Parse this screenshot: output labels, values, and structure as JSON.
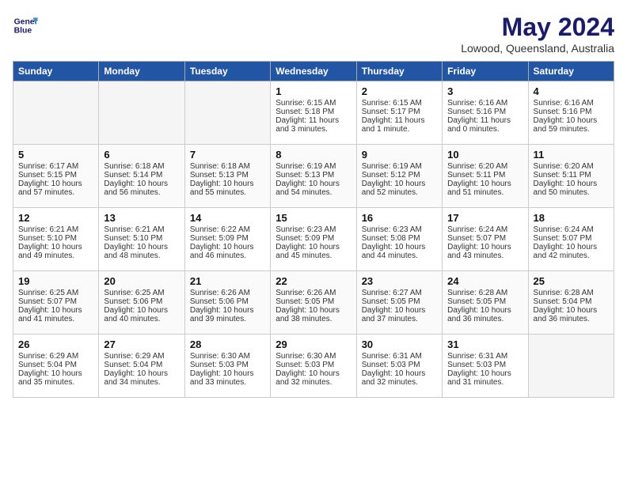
{
  "header": {
    "logo_line1": "General",
    "logo_line2": "Blue",
    "title": "May 2024",
    "subtitle": "Lowood, Queensland, Australia"
  },
  "days_of_week": [
    "Sunday",
    "Monday",
    "Tuesday",
    "Wednesday",
    "Thursday",
    "Friday",
    "Saturday"
  ],
  "weeks": [
    [
      {
        "day": "",
        "info": ""
      },
      {
        "day": "",
        "info": ""
      },
      {
        "day": "",
        "info": ""
      },
      {
        "day": "1",
        "info": "Sunrise: 6:15 AM\nSunset: 5:18 PM\nDaylight: 11 hours and 3 minutes."
      },
      {
        "day": "2",
        "info": "Sunrise: 6:15 AM\nSunset: 5:17 PM\nDaylight: 11 hours and 1 minute."
      },
      {
        "day": "3",
        "info": "Sunrise: 6:16 AM\nSunset: 5:16 PM\nDaylight: 11 hours and 0 minutes."
      },
      {
        "day": "4",
        "info": "Sunrise: 6:16 AM\nSunset: 5:16 PM\nDaylight: 10 hours and 59 minutes."
      }
    ],
    [
      {
        "day": "5",
        "info": "Sunrise: 6:17 AM\nSunset: 5:15 PM\nDaylight: 10 hours and 57 minutes."
      },
      {
        "day": "6",
        "info": "Sunrise: 6:18 AM\nSunset: 5:14 PM\nDaylight: 10 hours and 56 minutes."
      },
      {
        "day": "7",
        "info": "Sunrise: 6:18 AM\nSunset: 5:13 PM\nDaylight: 10 hours and 55 minutes."
      },
      {
        "day": "8",
        "info": "Sunrise: 6:19 AM\nSunset: 5:13 PM\nDaylight: 10 hours and 54 minutes."
      },
      {
        "day": "9",
        "info": "Sunrise: 6:19 AM\nSunset: 5:12 PM\nDaylight: 10 hours and 52 minutes."
      },
      {
        "day": "10",
        "info": "Sunrise: 6:20 AM\nSunset: 5:11 PM\nDaylight: 10 hours and 51 minutes."
      },
      {
        "day": "11",
        "info": "Sunrise: 6:20 AM\nSunset: 5:11 PM\nDaylight: 10 hours and 50 minutes."
      }
    ],
    [
      {
        "day": "12",
        "info": "Sunrise: 6:21 AM\nSunset: 5:10 PM\nDaylight: 10 hours and 49 minutes."
      },
      {
        "day": "13",
        "info": "Sunrise: 6:21 AM\nSunset: 5:10 PM\nDaylight: 10 hours and 48 minutes."
      },
      {
        "day": "14",
        "info": "Sunrise: 6:22 AM\nSunset: 5:09 PM\nDaylight: 10 hours and 46 minutes."
      },
      {
        "day": "15",
        "info": "Sunrise: 6:23 AM\nSunset: 5:09 PM\nDaylight: 10 hours and 45 minutes."
      },
      {
        "day": "16",
        "info": "Sunrise: 6:23 AM\nSunset: 5:08 PM\nDaylight: 10 hours and 44 minutes."
      },
      {
        "day": "17",
        "info": "Sunrise: 6:24 AM\nSunset: 5:07 PM\nDaylight: 10 hours and 43 minutes."
      },
      {
        "day": "18",
        "info": "Sunrise: 6:24 AM\nSunset: 5:07 PM\nDaylight: 10 hours and 42 minutes."
      }
    ],
    [
      {
        "day": "19",
        "info": "Sunrise: 6:25 AM\nSunset: 5:07 PM\nDaylight: 10 hours and 41 minutes."
      },
      {
        "day": "20",
        "info": "Sunrise: 6:25 AM\nSunset: 5:06 PM\nDaylight: 10 hours and 40 minutes."
      },
      {
        "day": "21",
        "info": "Sunrise: 6:26 AM\nSunset: 5:06 PM\nDaylight: 10 hours and 39 minutes."
      },
      {
        "day": "22",
        "info": "Sunrise: 6:26 AM\nSunset: 5:05 PM\nDaylight: 10 hours and 38 minutes."
      },
      {
        "day": "23",
        "info": "Sunrise: 6:27 AM\nSunset: 5:05 PM\nDaylight: 10 hours and 37 minutes."
      },
      {
        "day": "24",
        "info": "Sunrise: 6:28 AM\nSunset: 5:05 PM\nDaylight: 10 hours and 36 minutes."
      },
      {
        "day": "25",
        "info": "Sunrise: 6:28 AM\nSunset: 5:04 PM\nDaylight: 10 hours and 36 minutes."
      }
    ],
    [
      {
        "day": "26",
        "info": "Sunrise: 6:29 AM\nSunset: 5:04 PM\nDaylight: 10 hours and 35 minutes."
      },
      {
        "day": "27",
        "info": "Sunrise: 6:29 AM\nSunset: 5:04 PM\nDaylight: 10 hours and 34 minutes."
      },
      {
        "day": "28",
        "info": "Sunrise: 6:30 AM\nSunset: 5:03 PM\nDaylight: 10 hours and 33 minutes."
      },
      {
        "day": "29",
        "info": "Sunrise: 6:30 AM\nSunset: 5:03 PM\nDaylight: 10 hours and 32 minutes."
      },
      {
        "day": "30",
        "info": "Sunrise: 6:31 AM\nSunset: 5:03 PM\nDaylight: 10 hours and 32 minutes."
      },
      {
        "day": "31",
        "info": "Sunrise: 6:31 AM\nSunset: 5:03 PM\nDaylight: 10 hours and 31 minutes."
      },
      {
        "day": "",
        "info": ""
      }
    ]
  ]
}
